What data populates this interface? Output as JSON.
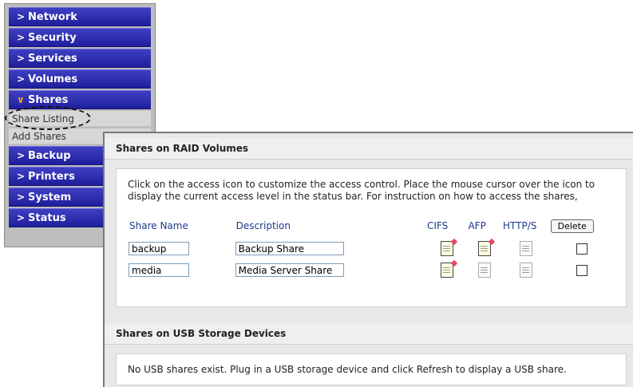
{
  "sidebar": {
    "items": [
      {
        "label": "Network",
        "expanded": false
      },
      {
        "label": "Security",
        "expanded": false
      },
      {
        "label": "Services",
        "expanded": false
      },
      {
        "label": "Volumes",
        "expanded": false
      },
      {
        "label": "Shares",
        "expanded": true
      },
      {
        "label": "Backup",
        "expanded": false
      },
      {
        "label": "Printers",
        "expanded": false
      },
      {
        "label": "System",
        "expanded": false
      },
      {
        "label": "Status",
        "expanded": false
      }
    ],
    "subitems": [
      {
        "label": "Share Listing",
        "active": true
      },
      {
        "label": "Add Shares",
        "active": false
      }
    ]
  },
  "raid": {
    "title": "Shares on RAID Volumes",
    "intro": "Click on the access icon to customize the access control. Place the mouse cursor over the icon to display the current access level in the status bar. For instruction on how to access the shares,",
    "columns": {
      "name": "Share Name",
      "description": "Description",
      "cifs": "CIFS",
      "afp": "AFP",
      "http": "HTTP/S",
      "delete": "Delete"
    },
    "rows": [
      {
        "name": "backup",
        "description": "Backup Share",
        "cifs": "active",
        "afp": "active",
        "http": "inactive",
        "delete_checked": false
      },
      {
        "name": "media",
        "description": "Media Server Share",
        "cifs": "active",
        "afp": "inactive",
        "http": "inactive",
        "delete_checked": false
      }
    ]
  },
  "usb": {
    "title": "Shares on USB Storage Devices",
    "message": "No USB shares exist. Plug in a USB storage device and click Refresh to display a USB share."
  },
  "colors": {
    "nav_bg": "#2a2aa8",
    "expanded_chevron": "#f0a030",
    "header_text": "#1a3a8a"
  },
  "icons": {
    "nav_chevron": "chevron-right-icon",
    "expanded_chevron": "chevron-down-icon",
    "share_access": "share-access-icon"
  }
}
